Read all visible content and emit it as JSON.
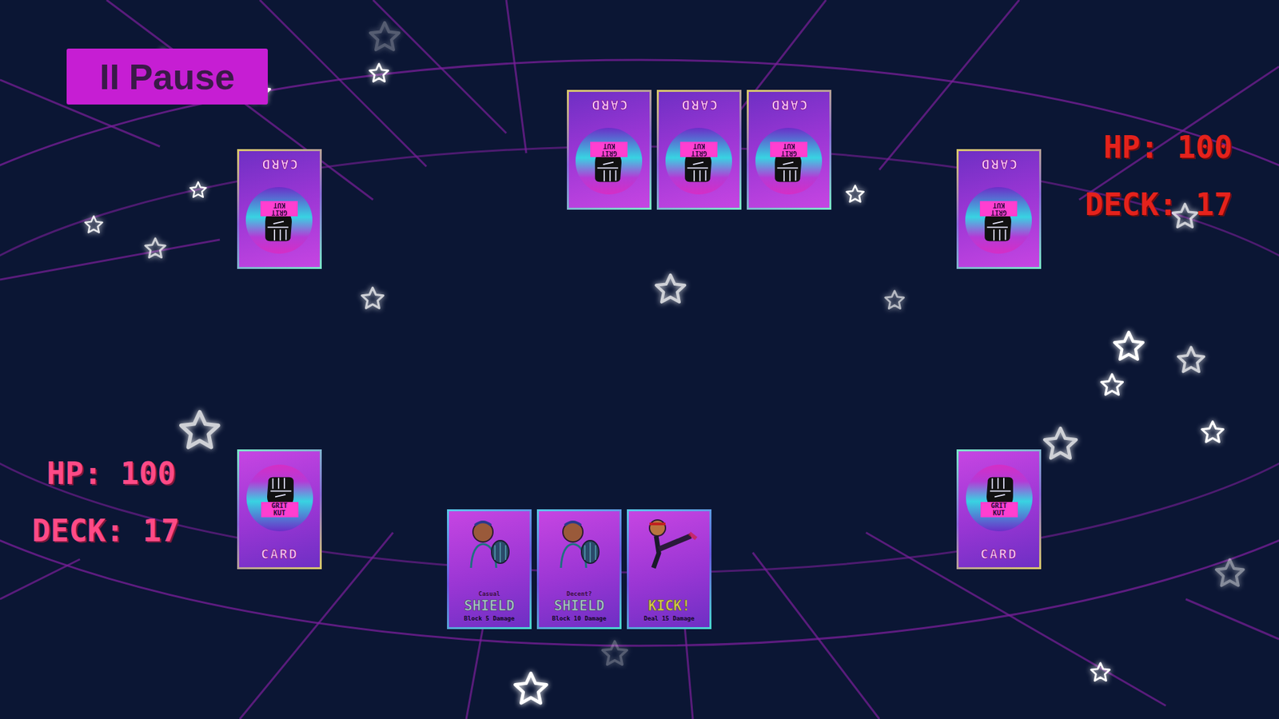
{
  "pause_button": {
    "icon": "II",
    "label": "Pause"
  },
  "opponent": {
    "hp": "HP: 100",
    "deck": "DECK: 17",
    "hand": [
      {
        "label": "CARD",
        "banner": [
          "GRIT",
          "KUT"
        ],
        "upside_down": true
      },
      {
        "label": "CARD",
        "banner": [
          "GRIT",
          "KUT"
        ],
        "upside_down": true
      },
      {
        "label": "CARD",
        "banner": [
          "GRIT",
          "KUT"
        ],
        "upside_down": true
      }
    ],
    "piles": [
      {
        "label": "CARD",
        "banner": [
          "GRIT",
          "KUT"
        ],
        "upside_down": true
      },
      {
        "label": "CARD",
        "banner": [
          "GRIT",
          "KUT"
        ],
        "upside_down": true
      }
    ]
  },
  "player": {
    "hp": "HP: 100",
    "deck": "DECK: 17",
    "piles": [
      {
        "label": "CARD",
        "banner": [
          "GRIT",
          "KUT"
        ],
        "upside_down": false
      },
      {
        "label": "CARD",
        "banner": [
          "GRIT",
          "KUT"
        ],
        "upside_down": false
      }
    ],
    "hand": [
      {
        "kind": "shield",
        "subtitle": "Casual",
        "title": "SHIELD",
        "effect": "Block 5 Damage"
      },
      {
        "kind": "shield",
        "subtitle": "Decent?",
        "title": "SHIELD",
        "effect": "Block 10 Damage"
      },
      {
        "kind": "kick",
        "subtitle": "",
        "title": "KICK!",
        "effect": "Deal 15 Damage"
      }
    ]
  }
}
